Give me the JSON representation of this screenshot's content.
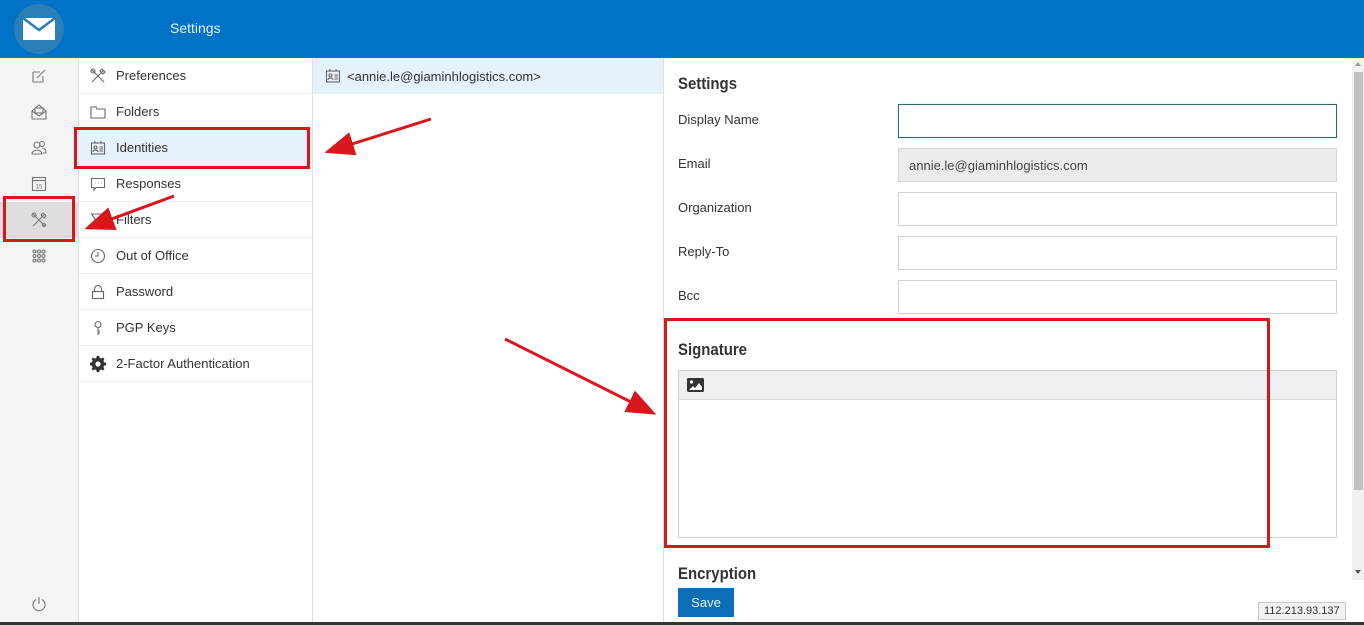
{
  "header": {
    "title": "Settings",
    "logo_icon": "envelope-icon"
  },
  "app_bar": {
    "items": [
      {
        "name": "compose",
        "icon": "compose-icon",
        "active": false
      },
      {
        "name": "mail",
        "icon": "mail-open-icon",
        "active": false
      },
      {
        "name": "contacts",
        "icon": "contacts-icon",
        "active": false
      },
      {
        "name": "calendar",
        "icon": "calendar-icon",
        "calendar_day": "15",
        "active": false
      },
      {
        "name": "settings",
        "icon": "tools-icon",
        "active": true
      },
      {
        "name": "apps",
        "icon": "apps-grid-icon",
        "active": false
      }
    ],
    "logout_icon": "power-icon"
  },
  "settings_nav": {
    "items": [
      {
        "label": "Preferences",
        "icon": "tools-icon",
        "selected": false
      },
      {
        "label": "Folders",
        "icon": "folder-icon",
        "selected": false
      },
      {
        "label": "Identities",
        "icon": "id-card-icon",
        "selected": true
      },
      {
        "label": "Responses",
        "icon": "comment-icon",
        "selected": false
      },
      {
        "label": "Filters",
        "icon": "filter-icon",
        "selected": false
      },
      {
        "label": "Out of Office",
        "icon": "clock-icon",
        "selected": false
      },
      {
        "label": "Password",
        "icon": "lock-icon",
        "selected": false
      },
      {
        "label": "PGP Keys",
        "icon": "key-icon",
        "selected": false
      },
      {
        "label": "2-Factor Authentication",
        "icon": "gear-icon",
        "selected": false
      }
    ]
  },
  "identities": {
    "items": [
      {
        "label": "<annie.le@giaminhlogistics.com>",
        "selected": true
      }
    ]
  },
  "identity_form": {
    "settings_title": "Settings",
    "fields": {
      "display_name": {
        "label": "Display Name",
        "value": ""
      },
      "email": {
        "label": "Email",
        "value": "annie.le@giaminhlogistics.com"
      },
      "organization": {
        "label": "Organization",
        "value": ""
      },
      "reply_to": {
        "label": "Reply-To",
        "value": ""
      },
      "bcc": {
        "label": "Bcc",
        "value": ""
      }
    },
    "signature_title": "Signature",
    "signature_value": "",
    "encryption_title": "Encryption",
    "save_label": "Save"
  },
  "status": {
    "ip_address": "112.213.93.137"
  },
  "colors": {
    "brand": "#0073c6",
    "selected_bg": "#e6f2fb",
    "annotation": "#d8161c",
    "save_button": "#0d6eb8"
  }
}
